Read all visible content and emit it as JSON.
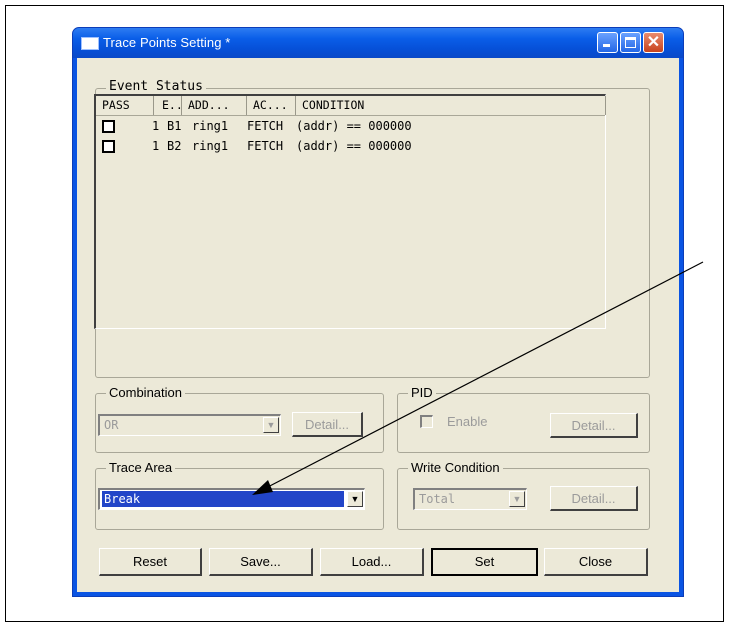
{
  "window": {
    "title": "Trace Points Setting *"
  },
  "event_status": {
    "label": "Event Status",
    "columns": [
      "PASS",
      "E..",
      "ADD...",
      "AC...",
      "CONDITION"
    ],
    "rows": [
      {
        "pass": "",
        "e_count": "1",
        "event": "B1",
        "address": "ring1",
        "access": "FETCH",
        "condition": "(addr) == 000000"
      },
      {
        "pass": "",
        "e_count": "1",
        "event": "B2",
        "address": "ring1",
        "access": "FETCH",
        "condition": "(addr) == 000000"
      }
    ]
  },
  "combination": {
    "label": "Combination",
    "value": "OR",
    "detail_label": "Detail..."
  },
  "pid": {
    "label": "PID",
    "enable_label": "Enable",
    "detail_label": "Detail..."
  },
  "trace_area": {
    "label": "Trace Area",
    "value": "Break"
  },
  "write_condition": {
    "label": "Write Condition",
    "value": "Total",
    "detail_label": "Detail..."
  },
  "buttons": {
    "reset": "Reset",
    "save": "Save...",
    "load": "Load...",
    "set": "Set",
    "close": "Close"
  }
}
